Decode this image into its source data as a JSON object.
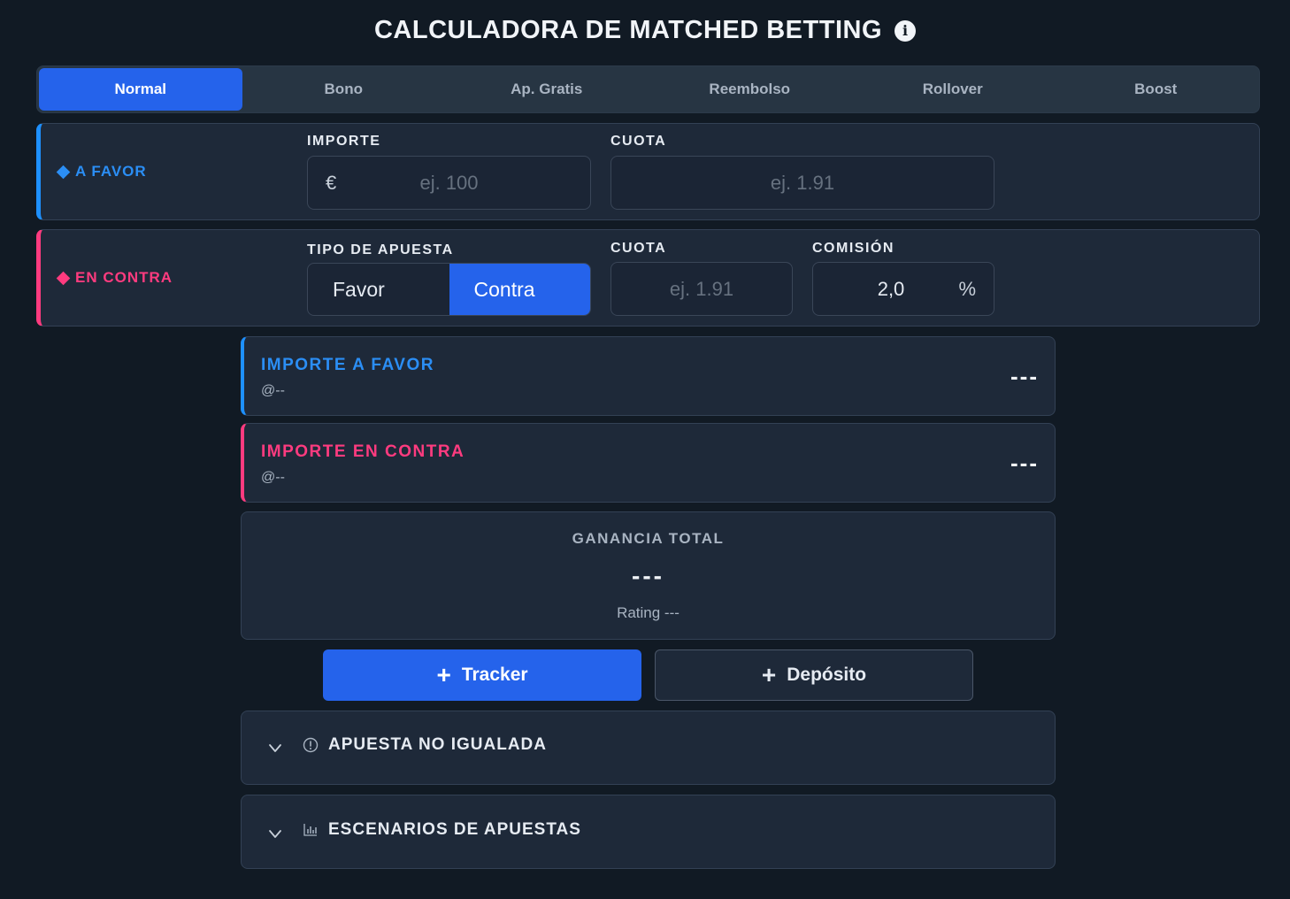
{
  "header": {
    "title": "CALCULADORA DE MATCHED BETTING"
  },
  "tabs": [
    {
      "label": "Normal",
      "active": true
    },
    {
      "label": "Bono",
      "active": false
    },
    {
      "label": "Ap. Gratis",
      "active": false
    },
    {
      "label": "Reembolso",
      "active": false
    },
    {
      "label": "Rollover",
      "active": false
    },
    {
      "label": "Boost",
      "active": false
    }
  ],
  "favor": {
    "label": "A FAVOR",
    "importe_label": "IMPORTE",
    "currency": "€",
    "importe_placeholder": "ej. 100",
    "cuota_label": "CUOTA",
    "cuota_placeholder": "ej. 1.91"
  },
  "contra": {
    "label": "EN CONTRA",
    "tipo_label": "TIPO DE APUESTA",
    "tipo_options": [
      "Favor",
      "Contra"
    ],
    "tipo_selected": "Contra",
    "cuota_label": "CUOTA",
    "cuota_placeholder": "ej. 1.91",
    "comision_label": "COMISIÓN",
    "comision_value": "2,0",
    "comision_unit": "%"
  },
  "results": {
    "favor": {
      "title": "IMPORTE A FAVOR",
      "sub": "@--",
      "value": "---"
    },
    "contra": {
      "title": "IMPORTE EN CONTRA",
      "sub": "@--",
      "value": "---"
    }
  },
  "total": {
    "label": "GANANCIA TOTAL",
    "value": "---",
    "rating": "Rating ---"
  },
  "actions": {
    "tracker": "Tracker",
    "deposito": "Depósito"
  },
  "accordions": [
    {
      "label": "APUESTA NO IGUALADA",
      "icon": "alert-circle-icon"
    },
    {
      "label": "ESCENARIOS DE APUESTAS",
      "icon": "bar-chart-icon"
    }
  ],
  "colors": {
    "accent": "#2563eb",
    "favor": "#2b8ef5",
    "contra": "#ff3b7f",
    "background": "#111a24",
    "panel": "#1e2939"
  }
}
